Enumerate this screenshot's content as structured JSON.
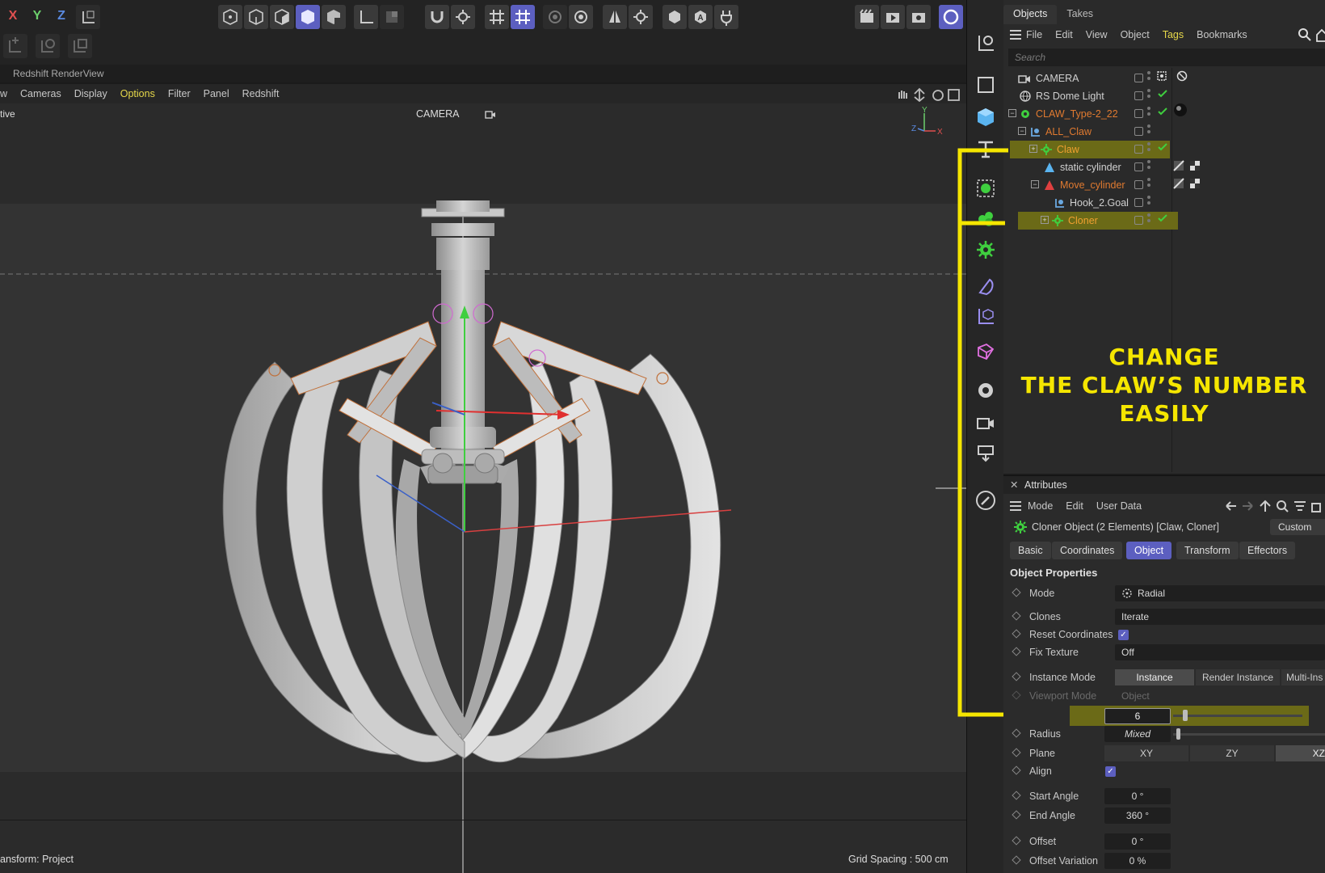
{
  "toolbar": {
    "axis_x": "X",
    "axis_y": "Y",
    "axis_z": "Z"
  },
  "renderview": {
    "title": "Redshift RenderView"
  },
  "viewport_menu": {
    "items": [
      "w",
      "Cameras",
      "Display",
      "Options",
      "Filter",
      "Panel",
      "Redshift"
    ],
    "highlighted": "Options"
  },
  "viewport": {
    "mode_label": "tive",
    "camera_label": "CAMERA",
    "status_left": "ansform: Project",
    "grid_spacing": "Grid Spacing : 500 cm"
  },
  "objects_panel": {
    "tabs": [
      "Objects",
      "Takes"
    ],
    "active_tab": "Objects",
    "menu": [
      "File",
      "Edit",
      "View",
      "Object",
      "Tags",
      "Bookmarks"
    ],
    "highlighted_menu": "Tags",
    "search_placeholder": "Search",
    "tree": [
      {
        "label": "CAMERA",
        "color": "#d0d0d0"
      },
      {
        "label": "RS Dome Light",
        "color": "#d0d0d0"
      },
      {
        "label": "CLAW_Type-2_22",
        "color": "#e07a30"
      },
      {
        "label": "ALL_Claw",
        "color": "#e07a30"
      },
      {
        "label": "Claw",
        "color": "#f0a030"
      },
      {
        "label": "static cylinder",
        "color": "#d0d0d0"
      },
      {
        "label": "Move_cylinder",
        "color": "#e07a30"
      },
      {
        "label": "Hook_2.Goal",
        "color": "#d0d0d0"
      },
      {
        "label": "Cloner",
        "color": "#f0a030"
      }
    ]
  },
  "annotation": {
    "line1": "CHANGE",
    "line2": "THE CLAW’S NUMBER",
    "line3": "EASILY",
    "color": "#f5e600"
  },
  "attributes": {
    "title": "Attributes",
    "menu": [
      "Mode",
      "Edit",
      "User Data"
    ],
    "object_title": "Cloner Object (2 Elements) [Claw, Cloner]",
    "custom_label": "Custom",
    "tabs": [
      "Basic",
      "Coordinates",
      "Object",
      "Transform",
      "Effectors"
    ],
    "active_tab": "Object",
    "section": "Object Properties",
    "props": {
      "mode_label": "Mode",
      "mode_value": "Radial",
      "clones_label": "Clones",
      "clones_value": "Iterate",
      "reset_label": "Reset Coordinates",
      "fix_label": "Fix Texture",
      "fix_value": "Off",
      "instance_label": "Instance Mode",
      "instance_options": [
        "Instance",
        "Render Instance",
        "Multi-Ins"
      ],
      "viewport_label": "Viewport Mode",
      "viewport_value": "Object",
      "count_value": "6",
      "radius_label": "Radius",
      "radius_value": "Mixed",
      "plane_label": "Plane",
      "plane_options": [
        "XY",
        "ZY",
        "XZ"
      ],
      "align_label": "Align",
      "start_label": "Start Angle",
      "start_value": "0 °",
      "end_label": "End Angle",
      "end_value": "360 °",
      "offset_label": "Offset",
      "offset_value": "0 °",
      "offvar_label": "Offset Variation",
      "offvar_value": "0 %"
    }
  },
  "colors": {
    "accent": "#5c5fc0",
    "highlight_row": "#6b6a17",
    "annotation_yellow": "#f5e600"
  }
}
